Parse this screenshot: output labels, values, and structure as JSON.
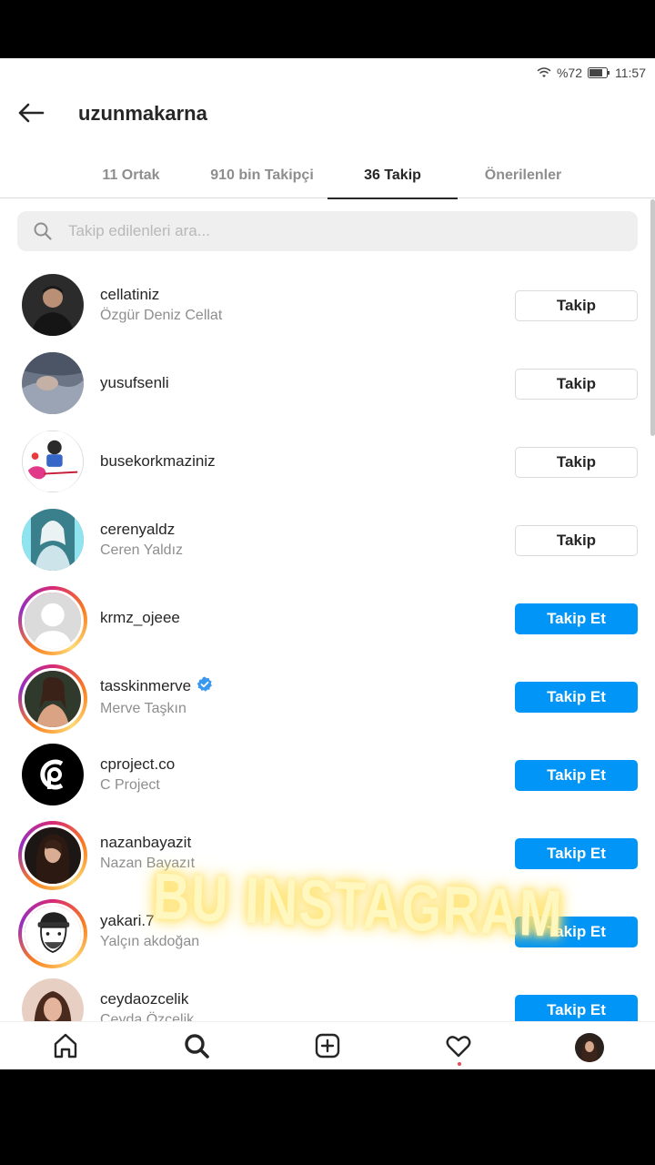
{
  "status_bar": {
    "battery_text": "%72",
    "time": "11:57"
  },
  "header": {
    "username": "uzunmakarna"
  },
  "tabs": [
    {
      "label": "11 Ortak",
      "active": false
    },
    {
      "label": "910 bin Takipçi",
      "active": false
    },
    {
      "label": "36 Takip",
      "active": true
    },
    {
      "label": "Önerilenler",
      "active": false
    }
  ],
  "search": {
    "placeholder": "Takip edilenleri ara..."
  },
  "following": [
    {
      "username": "cellatiniz",
      "full_name": "Özgür Deniz Cellat",
      "button": "Takip",
      "verified": false
    },
    {
      "username": "yusufsenli",
      "full_name": "",
      "button": "Takip",
      "verified": false
    },
    {
      "username": "busekorkmaziniz",
      "full_name": "",
      "button": "Takip",
      "verified": false
    },
    {
      "username": "cerenyaldz",
      "full_name": "Ceren Yaldız",
      "button": "Takip",
      "verified": false
    },
    {
      "username": "krmz_ojeee",
      "full_name": "",
      "button": "Takip Et",
      "verified": false
    },
    {
      "username": "tasskinmerve",
      "full_name": "Merve Taşkın",
      "button": "Takip Et",
      "verified": true
    },
    {
      "username": "cproject.co",
      "full_name": "C Project",
      "button": "Takip Et",
      "verified": false
    },
    {
      "username": "nazanbayazit",
      "full_name": "Nazan Bayazıt",
      "button": "Takip Et",
      "verified": false
    },
    {
      "username": "yakari.7",
      "full_name": "Yalçın akdoğan",
      "button": "Takip Et",
      "verified": false
    },
    {
      "username": "ceydaozcelik",
      "full_name": "Ceyda Özçelik",
      "button": "Takip Et",
      "verified": false
    }
  ],
  "overlay": {
    "text": "BU INSTAGRAM"
  },
  "bottom_nav": [
    "home-icon",
    "search-icon",
    "add-post-icon",
    "activity-heart-icon",
    "profile-avatar"
  ],
  "colors": {
    "primary_button": "#0095f6",
    "muted_text": "#8e8e8e",
    "verified_badge": "#3897f0"
  }
}
